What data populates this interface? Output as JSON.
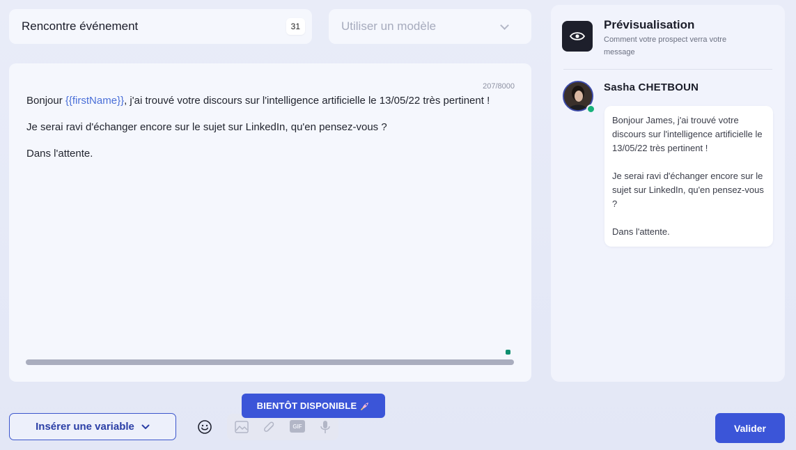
{
  "title_field": {
    "value": "Rencontre événement",
    "count": "31"
  },
  "template_select": {
    "placeholder": "Utiliser un modèle"
  },
  "editor": {
    "char_count": "207/8000",
    "line1_before": "Bonjour ",
    "variable_token": "{{firstName}}",
    "line1_after": ", j'ai trouvé votre discours sur l'intelligence artificielle le 13/05/22 très pertinent !",
    "paragraph2": "Je serai ravi d'échanger encore sur le sujet sur LinkedIn, qu'en pensez-vous ?",
    "paragraph3": "Dans l'attente."
  },
  "preview": {
    "title": "Prévisualisation",
    "subtitle": "Comment votre prospect verra votre message",
    "sender_name": "Sasha CHETBOUN",
    "message": {
      "p1": "Bonjour James, j'ai trouvé votre discours sur l'intelligence artificielle le 13/05/22 très pertinent !",
      "p2": "Je serai ravi d'échanger encore sur le sujet sur LinkedIn, qu'en pensez-vous ?",
      "p3": "Dans l'attente."
    }
  },
  "toolbar": {
    "insert_variable_label": "Insérer une variable",
    "soon_badge_label": "BIENTÔT DISPONIBLE",
    "gif_label": "GIF",
    "validate_label": "Valider"
  },
  "colors": {
    "accent": "#3b55d8",
    "online": "#18b27a",
    "variable": "#4a6fd8"
  },
  "icons": [
    "eye-icon",
    "chevron-down-icon",
    "emoji-icon",
    "image-icon",
    "paperclip-icon",
    "gif-icon",
    "microphone-icon",
    "rocket-icon"
  ]
}
